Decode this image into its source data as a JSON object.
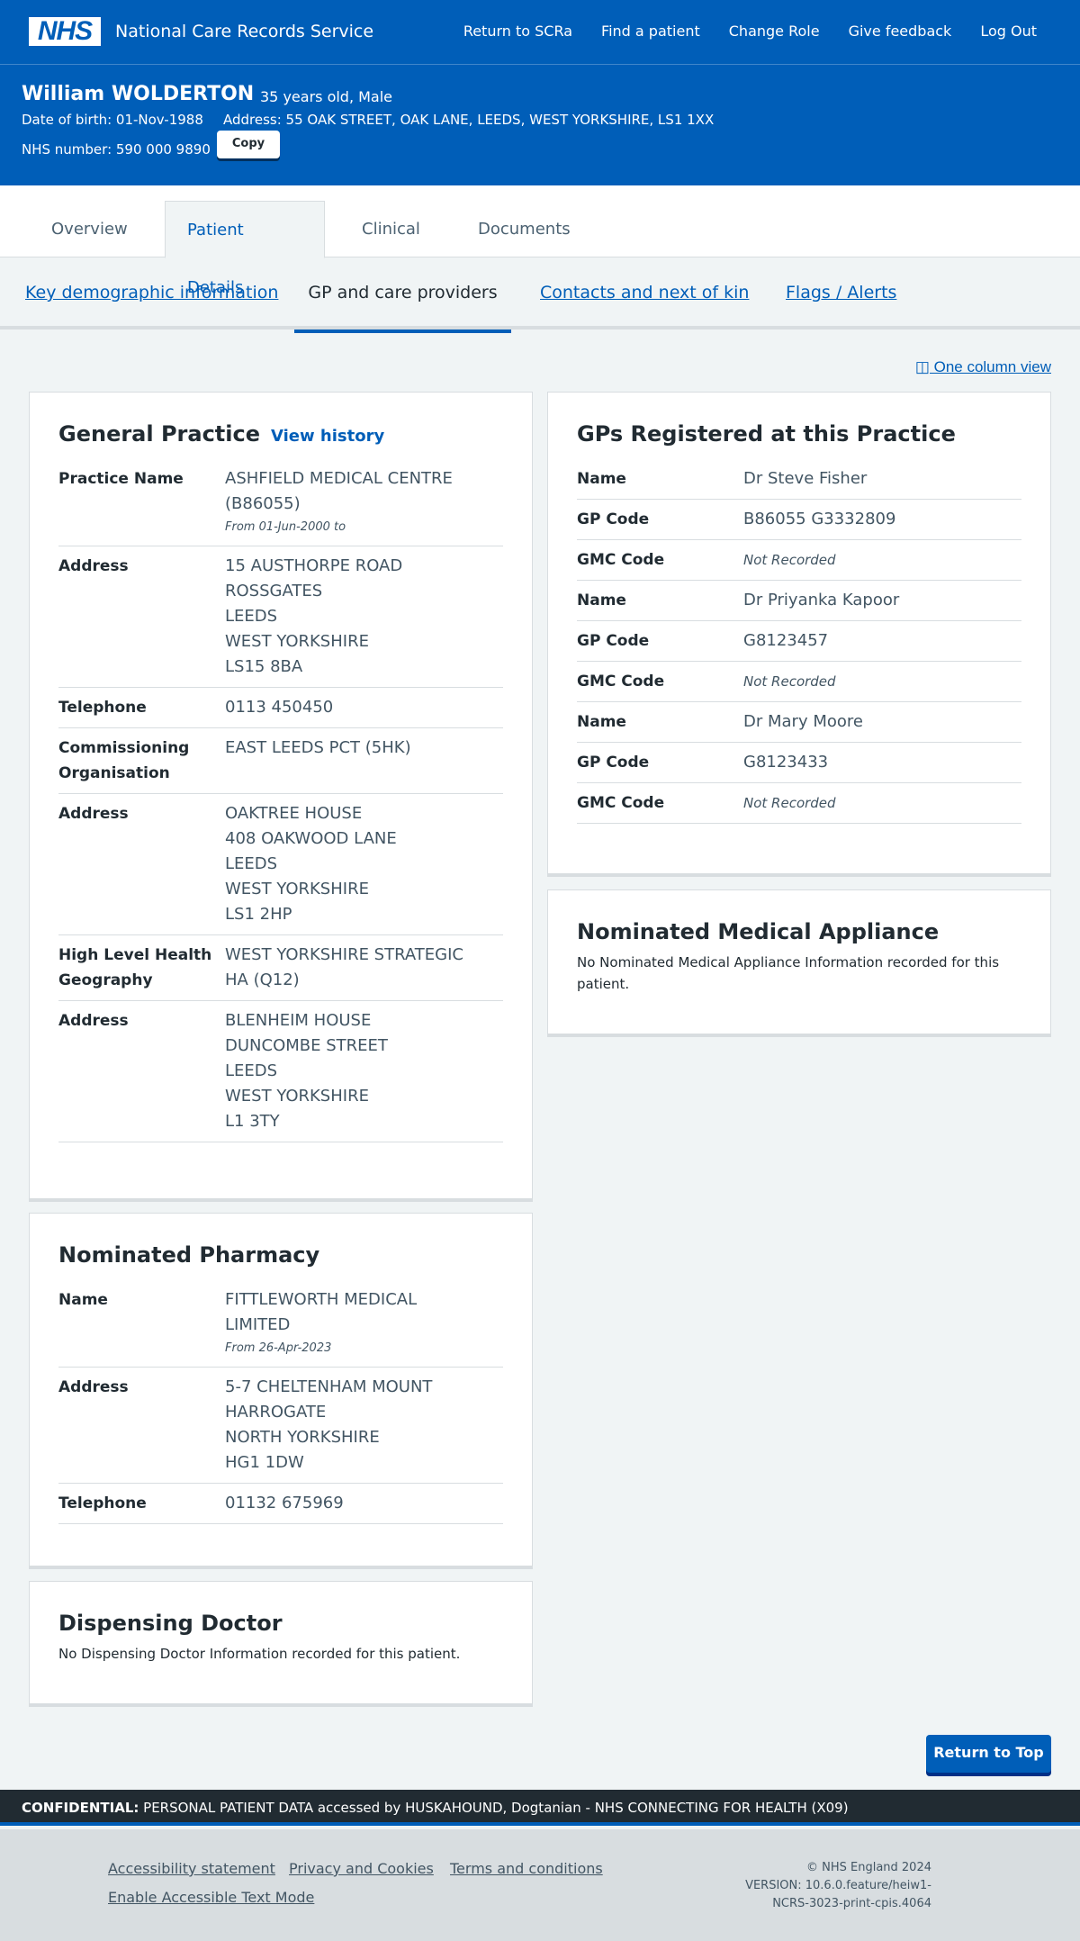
{
  "header": {
    "logo": "NHS",
    "service_name": "National Care Records Service",
    "nav": [
      "Return to SCRa",
      "Find a patient",
      "Change Role",
      "Give feedback",
      "Log Out"
    ]
  },
  "patient": {
    "name": "William WOLDERTON",
    "age_sex": "35 years old, Male",
    "dob": "Date of birth: 01-Nov-1988",
    "address": "Address: 55 OAK STREET, OAK LANE, LEEDS, WEST YORKSHIRE, LS1 1XX",
    "nhs_number": "NHS number: 590 000 9890",
    "copy_label": "Copy"
  },
  "tabs": [
    "Overview",
    "Patient Details",
    "Clinical",
    "Documents"
  ],
  "subnav": [
    "Key demographic information",
    "GP and care providers",
    "Contacts and next of kin",
    "Flags / Alerts"
  ],
  "one_column": "◫ One column view",
  "general_practice": {
    "title": "General Practice",
    "view_history": "View history",
    "practice_name_label": "Practice Name",
    "practice_name_1": "ASHFIELD MEDICAL CENTRE",
    "practice_name_2": "(B86055)",
    "practice_from": "From 01-Jun-2000 to",
    "address_label": "Address",
    "address": [
      "15 AUSTHORPE ROAD",
      "ROSSGATES",
      "LEEDS",
      "WEST YORKSHIRE",
      "LS15 8BA"
    ],
    "telephone_label": "Telephone",
    "telephone": "0113 450450",
    "commissioning_label_1": "Commissioning",
    "commissioning_label_2": "Organisation",
    "commissioning": "EAST LEEDS PCT (5HK)",
    "commissioning_address": [
      "OAKTREE HOUSE",
      "408 OAKWOOD LANE",
      "LEEDS",
      "WEST YORKSHIRE",
      "LS1 2HP"
    ],
    "hlhg_label_1": "High Level Health",
    "hlhg_label_2": "Geography",
    "hlhg_1": "WEST YORKSHIRE STRATEGIC",
    "hlhg_2": "HA (Q12)",
    "hlhg_address": [
      "BLENHEIM HOUSE",
      "DUNCOMBE STREET",
      "LEEDS",
      "WEST YORKSHIRE",
      "L1 3TY"
    ]
  },
  "gps": {
    "title": "GPs Registered at this Practice",
    "name_label": "Name",
    "gp_code_label": "GP Code",
    "gmc_code_label": "GMC Code",
    "list": [
      {
        "name": "Dr Steve Fisher",
        "gp_code": "B86055 G3332809",
        "gmc_code": "Not Recorded"
      },
      {
        "name": "Dr Priyanka Kapoor",
        "gp_code": "G8123457",
        "gmc_code": "Not Recorded"
      },
      {
        "name": "Dr Mary Moore",
        "gp_code": "G8123433",
        "gmc_code": "Not Recorded"
      }
    ]
  },
  "appliance": {
    "title": "Nominated Medical Appliance",
    "text": "No Nominated Medical Appliance Information recorded for this patient."
  },
  "pharmacy": {
    "title": "Nominated Pharmacy",
    "name_label": "Name",
    "name_1": "FITTLEWORTH MEDICAL",
    "name_2": "LIMITED",
    "from": "From 26-Apr-2023",
    "address_label": "Address",
    "address": [
      "5-7 CHELTENHAM MOUNT",
      "HARROGATE",
      "NORTH YORKSHIRE",
      "HG1 1DW"
    ],
    "telephone_label": "Telephone",
    "telephone": "01132 675969"
  },
  "dispensing": {
    "title": "Dispensing Doctor",
    "text": "No Dispensing Doctor Information recorded for this patient."
  },
  "return_top": "Return to Top",
  "confidential": {
    "label": "CONFIDENTIAL:",
    "text": "PERSONAL PATIENT DATA accessed by HUSKAHOUND, Dogtanian - NHS CONNECTING FOR HEALTH (X09)"
  },
  "footer": {
    "links": [
      "Accessibility statement",
      "Privacy and Cookies",
      "Terms and conditions",
      "Enable Accessible Text Mode"
    ],
    "copyright": "© NHS England 2024",
    "version_1": "VERSION: 10.6.0.feature/heiw1-",
    "version_2": "NCRS-3023-print-cpis.4064"
  }
}
